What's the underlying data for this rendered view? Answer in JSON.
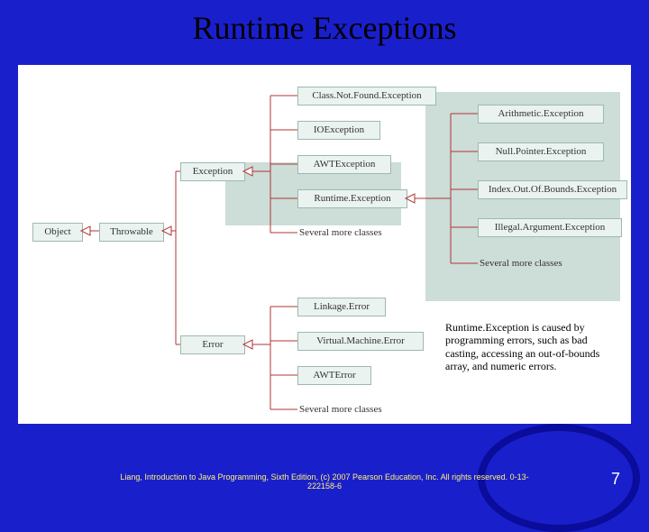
{
  "title": "Runtime Exceptions",
  "diagram": {
    "object": "Object",
    "throwable": "Throwable",
    "exception": "Exception",
    "error": "Error",
    "exception_children": {
      "classnotfound": "Class.Not.Found.Exception",
      "ioexception": "IOException",
      "awtexception": "AWTException",
      "runtimeexception": "Runtime.Exception",
      "more": "Several more classes"
    },
    "error_children": {
      "linkage": "Linkage.Error",
      "vmerror": "Virtual.Machine.Error",
      "awterror": "AWTError",
      "more": "Several more classes"
    },
    "runtime_children": {
      "arithmetic": "Arithmetic.Exception",
      "nullpointer": "Null.Pointer.Exception",
      "indexoob": "Index.Out.Of.Bounds.Exception",
      "illegalarg": "Illegal.Argument.Exception",
      "more": "Several more classes"
    }
  },
  "callout": "Runtime.Exception is caused by programming errors, such as bad casting, accessing an out-of-bounds array, and numeric errors.",
  "footer": "Liang, Introduction to Java Programming, Sixth Edition, (c) 2007 Pearson Education, Inc. All rights reserved. 0-13-222158-6",
  "page": "7"
}
